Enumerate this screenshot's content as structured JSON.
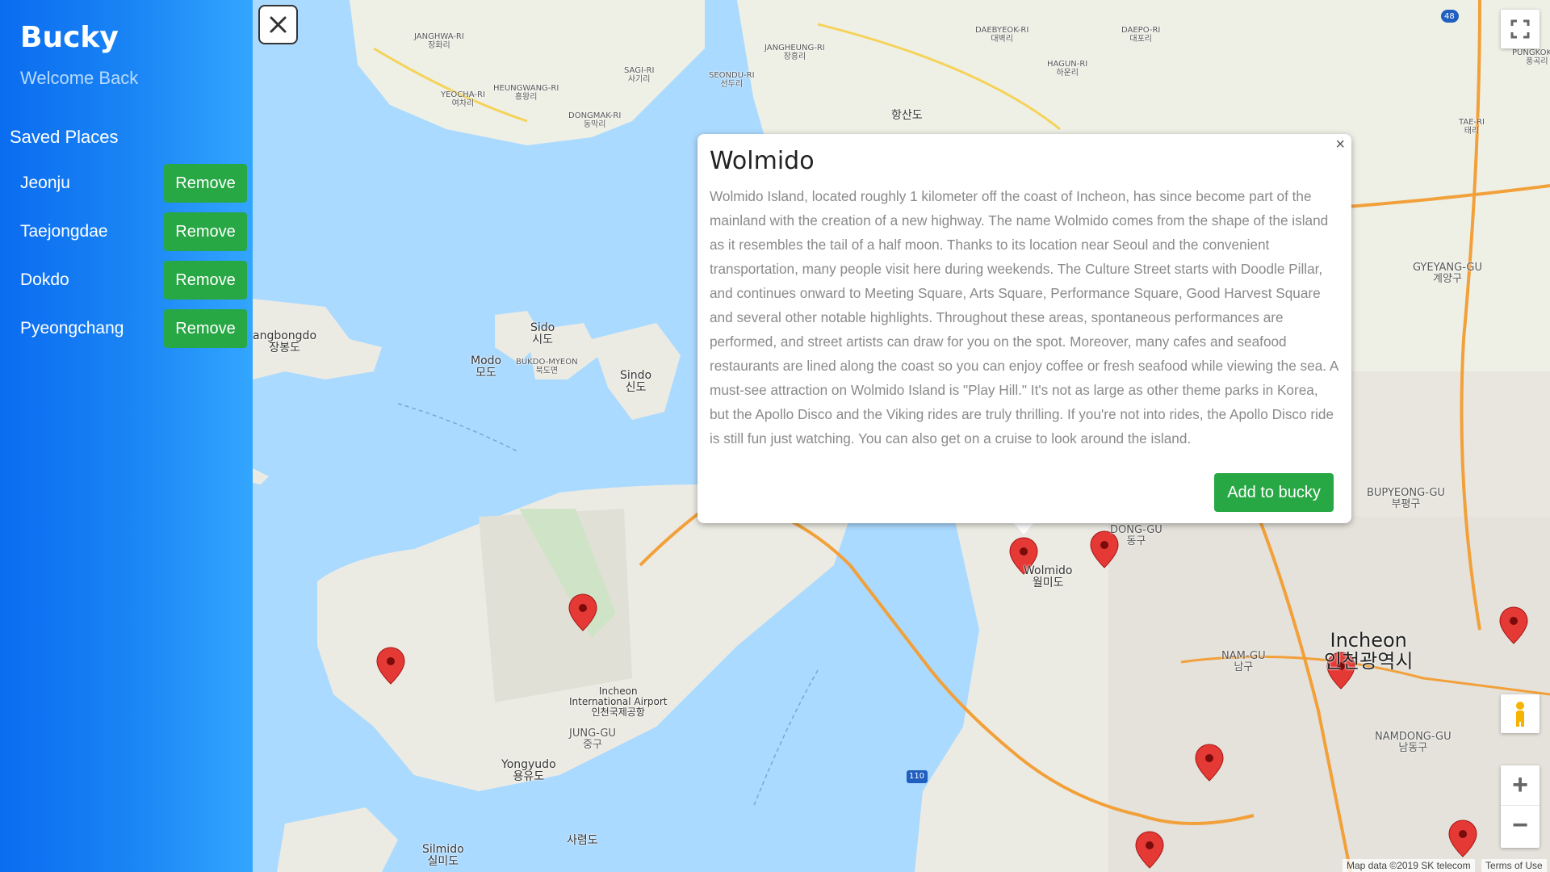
{
  "sidebar": {
    "title": "Bucky",
    "subtitle": "Welcome Back",
    "section_title": "Saved Places",
    "remove_label": "Remove",
    "places": [
      {
        "name": "Jeonju"
      },
      {
        "name": "Taejongdae"
      },
      {
        "name": "Dokdo"
      },
      {
        "name": "Pyeongchang"
      }
    ]
  },
  "close_button": {
    "icon": "close-icon"
  },
  "info_window": {
    "title": "Wolmido",
    "description": "Wolmido Island, located roughly 1 kilometer off the coast of Incheon, has since become part of the mainland with the creation of a new highway. The name Wolmido comes from the shape of the island as it resembles the tail of a half moon. Thanks to its location near Seoul and the convenient transportation, many people visit here during weekends. The Culture Street starts with Doodle Pillar, and continues onward to Meeting Square, Arts Square, Performance Square, Good Harvest Square and several other notable highlights. Throughout these areas, spontaneous performances are performed, and street artists can draw for you on the spot. Moreover, many cafes and seafood restaurants are lined along the coast so you can enjoy coffee or fresh seafood while viewing the sea. A must-see attraction on Wolmido Island is \"Play Hill.\" It's not as large as other theme parks in Korea, but the Apollo Disco and the Viking rides are truly thrilling. If you're not into rides, the Apollo Disco ride is still fun just watching. You can also get on a cruise to look around the island.",
    "close_symbol": "×",
    "add_label": "Add to bucky"
  },
  "map": {
    "labels": {
      "wolmido": "Wolmido\n월미도",
      "incheon": "Incheon\n인천광역시",
      "airport": "Incheon\nInternational Airport\n인천국제공항",
      "junggu": "JUNG-GU\n중구",
      "yongyudo": "Yongyudo\n용유도",
      "silmido": "Silmido\n실미도",
      "saryeongdo": "사렴도",
      "sido": "Sido\n시도",
      "modo": "Modo\n모도",
      "sindo": "Sindo\n신도",
      "bukdo": "BUKDO-MYEON\n북도면",
      "jangbongdo": "angbongdo\n장봉도",
      "hangsando": "항산도",
      "gyeyang": "GYEYANG-GU\n계양구",
      "bupyeong": "BUPYEONG-GU\n부평구",
      "namgu": "NAM-GU\n남구",
      "namdong": "NAMDONG-GU\n남동구",
      "donggu": "DONG-GU\n동구",
      "yeocha": "YEOCHA-RI\n여차리",
      "heungwang": "HEUNGWANG-RI\n흥왕리",
      "dongmak": "DONGMAK-RI\n동막리",
      "sagi": "SAGI-RI\n사기리",
      "seondu": "SEONDU-RI\n선두리",
      "jangheung": "JANGHEUNG-RI\n장흥리",
      "janghwa": "JANGHWA-RI\n장화리",
      "hagun": "HAGUN-RI\n하운리",
      "daebyeok": "DAEBYEOK-RI\n대벽리",
      "daepo": "DAEPO-RI\n대포리",
      "taeri": "TAE-RI\n태리",
      "pungkok": "PUNGKOK-RI\n풍곡리"
    },
    "highway_110": "110",
    "highway_48": "48",
    "attribution": "Map data ©2019 SK telecom",
    "terms": "Terms of Use",
    "zoom_in": "+",
    "zoom_out": "−",
    "fullscreen_icon": "fullscreen-icon",
    "pegman_icon": "pegman-icon"
  }
}
